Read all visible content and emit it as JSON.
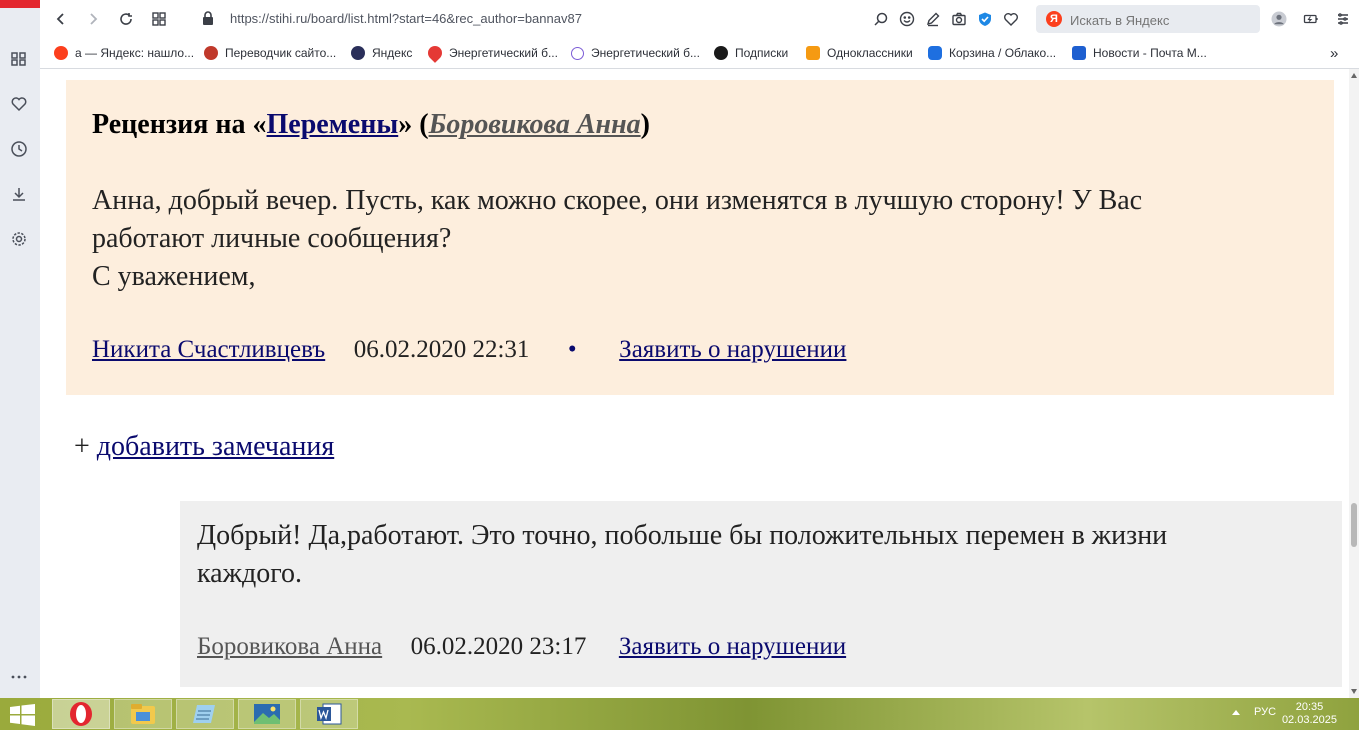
{
  "browser": {
    "url": "https://stihi.ru/board/list.html?start=46&rec_author=bannav87",
    "search_placeholder": "Искать в Яндекс",
    "search_logo": "Я"
  },
  "bookmarks": [
    {
      "label": "а — Яндекс: нашло...",
      "color": "#fc3f1d"
    },
    {
      "label": "Переводчик сайто...",
      "color": "#c0392b"
    },
    {
      "label": "Яндекс",
      "color": "#2a2f5a"
    },
    {
      "label": "Энергетический б...",
      "color": "#e53935"
    },
    {
      "label": "Энергетический б...",
      "color": "#7c5cd6"
    },
    {
      "label": "Подписки",
      "color": "#1a1a1a"
    },
    {
      "label": "Одноклассники",
      "color": "#f59a12"
    },
    {
      "label": "Корзина / Облако...",
      "color": "#1e6fe0"
    },
    {
      "label": "Новости - Почта М...",
      "color": "#1e5fd0"
    }
  ],
  "bookmarks_more": "»",
  "review": {
    "title_prefix": "Рецензия на «",
    "title_work": "Перемены",
    "title_mid": "» (",
    "title_author": "Боровикова Анна",
    "title_suffix": ")",
    "text_line1": "Анна, добрый вечер. Пусть, как можно скорее, они изменятся в лучшую сторону! У Вас",
    "text_line2": "работают личные сообщения?",
    "text_line3": "С уважением,",
    "author": "Никита Счастливцевъ",
    "datetime": "06.02.2020 22:31",
    "bullet": "•",
    "report": "Заявить о нарушении"
  },
  "add_note": {
    "plus": "+ ",
    "label": "добавить замечания"
  },
  "reply": {
    "text_line1": "Добрый! Да,работают. Это точно, побольше бы положительных перемен в жизни",
    "text_line2": "каждого.",
    "author": "Боровикова Анна",
    "datetime": "06.02.2020 23:17",
    "report": "Заявить о нарушении"
  },
  "taskbar": {
    "lang": "РУС",
    "time": "20:35",
    "date": "02.03.2025"
  }
}
